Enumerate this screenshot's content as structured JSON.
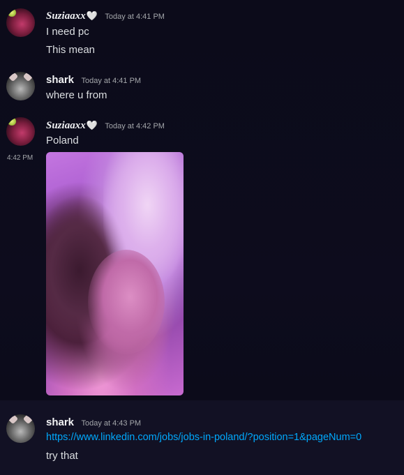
{
  "messages": [
    {
      "author": "Suziaaxx",
      "heart": "🤍",
      "timestamp": "Today at 4:41 PM",
      "lines": [
        "I need pc",
        "This mean"
      ]
    },
    {
      "author": "shark",
      "timestamp": "Today at 4:41 PM",
      "lines": [
        "where u from"
      ]
    },
    {
      "author": "Suziaaxx",
      "heart": "🤍",
      "timestamp": "Today at 4:42 PM",
      "lines": [
        "Poland"
      ],
      "attachment_time": "4:42 PM"
    },
    {
      "author": "shark",
      "timestamp": "Today at 4:43 PM",
      "link": "https://www.linkedin.com/jobs/jobs-in-poland/?position=1&pageNum=0",
      "lines": [
        "try that"
      ]
    }
  ],
  "colors": {
    "background": "#0d0c1b",
    "link": "#00a8fc",
    "username": "#f2f3f5",
    "text": "#dbdee1",
    "timestamp": "#a3a6aa"
  }
}
